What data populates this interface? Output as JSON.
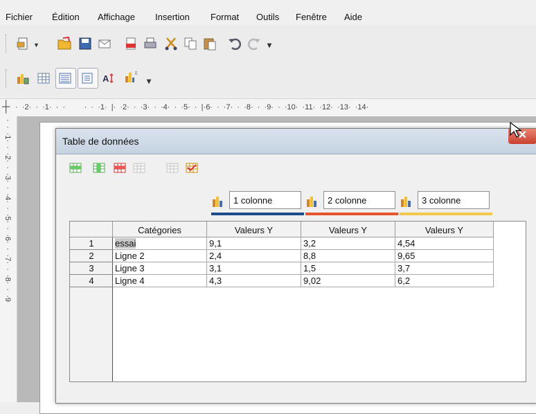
{
  "menu": [
    "Fichier",
    "Édition",
    "Affichage",
    "Insertion",
    "Format",
    "Outils",
    "Fenêtre",
    "Aide"
  ],
  "ruler": {
    "horizontal": "·  ·2·  ·  ·1·  ·  ·         ·  ·  ·1·  |·  ·2·  ·  ·3·  ·  ·4·  ·  ·5·  ·  |·6·  ·  ·7·  ·  ·8·  ·  ·9·  ·  ·10·  ·11·  ·12·  ·13·  ·14·",
    "vertical": "·  ·  ·1·  ·  ·2·  ·  ·3·  ·  ·4·  ·  ·5·  ·  ·6·  ·  ·7·  ·  ·8·  ·  ·9"
  },
  "dialog": {
    "title": "Table de données",
    "close_label": "✕"
  },
  "series_headers": [
    {
      "name": "1 colonne",
      "color": "#1e4c8c"
    },
    {
      "name": "2 colonne",
      "color": "#e8542c"
    },
    {
      "name": "3 colonne",
      "color": "#f2c94c"
    }
  ],
  "table": {
    "columns": [
      "Catégories",
      "Valeurs Y",
      "Valeurs Y",
      "Valeurs Y"
    ],
    "rows": [
      {
        "num": "1",
        "category": "essai",
        "values": [
          "9,1",
          "3,2",
          "4,54"
        ]
      },
      {
        "num": "2",
        "category": "Ligne 2",
        "values": [
          "2,4",
          "8,8",
          "9,65"
        ]
      },
      {
        "num": "3",
        "category": "Ligne 3",
        "values": [
          "3,1",
          "1,5",
          "3,7"
        ]
      },
      {
        "num": "4",
        "category": "Ligne 4",
        "values": [
          "4,3",
          "9,02",
          "6,2"
        ]
      }
    ]
  },
  "toolbar_icons": {
    "standard": [
      "new-icon",
      "open-icon",
      "save-icon",
      "email-icon",
      "pdf-icon",
      "print-icon",
      "cut-icon",
      "copy-icon",
      "paste-icon",
      "undo-icon",
      "redo-icon"
    ],
    "chart": [
      "chart-data-icon",
      "table-icon",
      "legend-icon",
      "data-labels-icon",
      "text-scale-icon",
      "chart-type-icon"
    ],
    "dialog": [
      "insert-row-icon",
      "insert-column-icon",
      "insert-text-column-icon",
      "delete-row-icon",
      "delete-column-icon",
      "move-series-icon"
    ]
  }
}
